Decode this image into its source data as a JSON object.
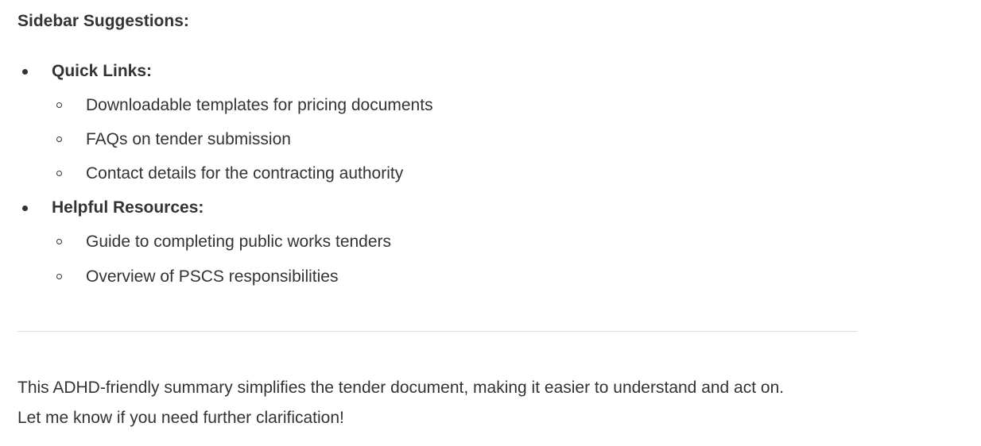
{
  "heading": "Sidebar Suggestions:",
  "sections": [
    {
      "label": "Quick Links:",
      "items": [
        "Downloadable templates for pricing documents",
        "FAQs on tender submission",
        "Contact details for the contracting authority"
      ]
    },
    {
      "label": "Helpful Resources:",
      "items": [
        "Guide to completing public works tenders",
        "Overview of PSCS responsibilities"
      ]
    }
  ],
  "closing": {
    "line1": "This ADHD-friendly summary simplifies the tender document, making it easier to understand and act on.",
    "line2": "Let me know if you need further clarification!"
  }
}
